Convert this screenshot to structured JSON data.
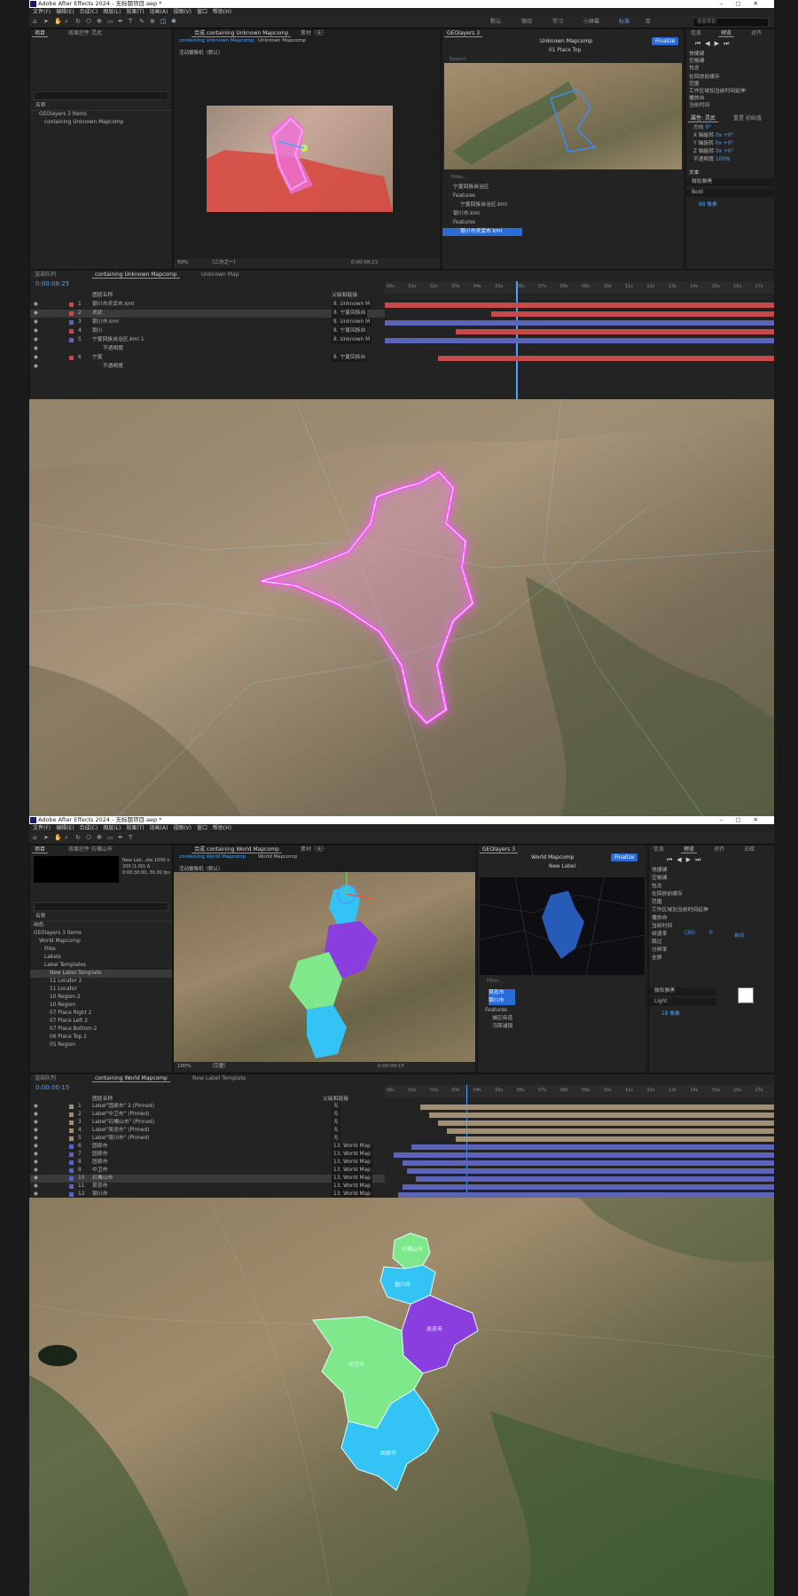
{
  "screen1": {
    "window_title": "Adobe After Effects 2024 - 无标题项目.aep *",
    "menu": [
      "文件(F)",
      "编辑(E)",
      "合成(C)",
      "图层(L)",
      "效果(T)",
      "动画(A)",
      "视图(V)",
      "窗口",
      "帮助(H)"
    ],
    "workspaces": [
      "默认",
      "审阅",
      "学习",
      "小屏幕",
      "标准",
      "库"
    ],
    "search_placeholder": "搜索帮助",
    "project_tab": "项目",
    "project_tab2": "效果控件 灵武",
    "project_header": "名称",
    "project_items": [
      "GEOlayers 3 Items",
      "containing Unknown Mapcomp"
    ],
    "comp_tab": "合成 containing Unknown Mapcomp",
    "comp_tab2": "素材（无）",
    "comp_breadcrumb1": "containing Unknown Mapcomp",
    "comp_breadcrumb2": "Unknown Mapcomp",
    "camera_label": "活动摄像机（默认）",
    "zoom": "50%",
    "resolution": "（二分之一）",
    "comp_time": "0:00:08:23",
    "geo_panel_title": "GEOlayers 3",
    "geo_map_title": "Unknown Mapcomp",
    "geo_place": "01 Place Top",
    "finalize": "Finalize",
    "geo_search": "Search",
    "geo_filter": "Filter...",
    "geo_tree": [
      "宁夏回族自治区",
      "Features",
      "宁夏回族自治区.kml",
      "银川市.kml",
      "Features",
      "银川市灵武市.kml"
    ],
    "right_tabs": [
      "信息",
      "预览",
      "对齐"
    ],
    "right_props": [
      "快捷键",
      "空格键",
      "包含",
      "在回放前缓存",
      "范围",
      "工作区域加当前时间延伸",
      "播放自",
      "当前时间"
    ],
    "props_tab": "属性: 灵武",
    "props_tab2": "重置 初始值",
    "props_rows": [
      "方向",
      "X 轴旋转",
      "Y 轴旋转",
      "Z 轴旋转",
      "不透明度"
    ],
    "props_values": [
      "0°",
      "0x +0°",
      "0x +0°",
      "0x +0°",
      "100%"
    ],
    "text_panel": "文本",
    "text_font": "微软雅黑",
    "text_weight": "Bold",
    "text_size": "98 像素",
    "timeline_tab": "渲染队列",
    "timeline_tab2": "containing Unknown Mapcomp",
    "timeline_tab3": "Unknown Map",
    "timeline_time": "0:00:08:25",
    "timeline_col_name": "图层名称",
    "timeline_col_parent": "父级和链接",
    "layers": [
      {
        "num": "1",
        "name": "银川市灵武市.kml",
        "parent": "8. Unknown M",
        "color": "#c74a4a"
      },
      {
        "num": "2",
        "name": "灵武",
        "parent": "8. 宁夏回族自",
        "color": "#c74a4a"
      },
      {
        "num": "3",
        "name": "银川市.kml",
        "parent": "8. Unknown M",
        "color": "#5b64b8"
      },
      {
        "num": "4",
        "name": "银川",
        "parent": "8. 宁夏回族自",
        "color": "#c74a4a"
      },
      {
        "num": "5",
        "name": "宁夏回族自治区.kml 1",
        "parent": "8. Unknown M",
        "color": "#5b64b8"
      },
      {
        "num": "",
        "name": "不透明度",
        "parent": "",
        "color": ""
      },
      {
        "num": "6",
        "name": "宁夏",
        "parent": "8. 宁夏回族自",
        "color": "#c74a4a"
      },
      {
        "num": "",
        "name": "不透明度",
        "parent": "",
        "color": ""
      }
    ],
    "opacity_value": "100%",
    "ruler": [
      "00s",
      "01s",
      "02s",
      "03s",
      "04s",
      "05s",
      "06s",
      "07s",
      "08s",
      "09s",
      "10s",
      "11s",
      "12s",
      "13s",
      "14s",
      "15s",
      "16s",
      "17s"
    ]
  },
  "screen2": {
    "window_title": "Adobe After Effects 2024 - 无标题项目.aep *",
    "menu": [
      "文件(F)",
      "编辑(E)",
      "合成(C)",
      "图层(L)",
      "效果(T)",
      "动画(A)",
      "视图(V)",
      "窗口",
      "帮助(H)"
    ],
    "project_tab": "项目",
    "project_tab2": "效果控件 石嘴山市",
    "project_thumb_info": "New Lab...ate  1000 x 200 (1.00)  Δ 0:00:30:00, 30.00 fps",
    "project_header": "名称",
    "project_items": [
      "纯色",
      "GEOlayers 3 Items",
      "World Mapcomp",
      "Files",
      "Labels",
      "Label Templates",
      "New Label Template",
      "11 Locator 2",
      "11 Locator",
      "10 Region 2",
      "10 Region",
      "07 Place Right 2",
      "07 Place Left 2",
      "07 Place Bottom 2",
      "06 Place Top 2",
      "05 Region"
    ],
    "comp_tab": "合成 containing World Mapcomp",
    "comp_tab2": "素材（无）",
    "comp_breadcrumb1": "containing World Mapcomp",
    "comp_breadcrumb2": "World Mapcomp",
    "camera_label": "活动摄像机（默认）",
    "zoom": "100%",
    "resolution": "（完整）",
    "comp_time": "0:00:00:15",
    "geo_panel_title": "GEOlayers 3",
    "geo_map_title": "World Mapcomp",
    "geo_label": "New Label",
    "finalize": "Finalize",
    "geo_filter": "Filter...",
    "geo_tree": [
      "吴忠市",
      "银川市",
      "Features",
      "城区街道",
      "乌斯浦镇"
    ],
    "right_tabs": [
      "信息",
      "预览",
      "对齐",
      "古碳"
    ],
    "right_props": [
      "快捷键",
      "空格键",
      "包含",
      "在回放前缓存",
      "范围",
      "工作区域加当前时间延伸",
      "播放自",
      "当前时间",
      "帧速率",
      "跳过",
      "分辨率",
      "全屏"
    ],
    "right_values": [
      "(30)",
      "0",
      "自动"
    ],
    "text_font": "微软雅黑",
    "text_weight": "Light",
    "text_size": "18 像素",
    "timeline_tab": "渲染队列",
    "timeline_tab2": "containing World Mapcomp",
    "timeline_tab3": "New Label Template",
    "timeline_time": "0:00:00:15",
    "timeline_col_name": "图层名称",
    "timeline_col_parent": "父级和链接",
    "layers": [
      {
        "num": "1",
        "name": "Label\"固原市\" 2 (Pinned)",
        "parent": "无",
        "color": "#a08f74"
      },
      {
        "num": "2",
        "name": "Label\"中卫市\" (Pinned)",
        "parent": "无",
        "color": "#a08f74"
      },
      {
        "num": "3",
        "name": "Label\"石嘴山市\" (Pinned)",
        "parent": "无",
        "color": "#a08f74"
      },
      {
        "num": "4",
        "name": "Label\"吴忠市\" (Pinned)",
        "parent": "无",
        "color": "#a08f74"
      },
      {
        "num": "5",
        "name": "Label\"银川市\" (Pinned)",
        "parent": "无",
        "color": "#a08f74"
      },
      {
        "num": "6",
        "name": "固原市",
        "parent": "13. World Map",
        "color": "#5b64b8"
      },
      {
        "num": "7",
        "name": "固原市",
        "parent": "13. World Map",
        "color": "#5b64b8"
      },
      {
        "num": "8",
        "name": "固原市",
        "parent": "13. World Map",
        "color": "#5b64b8"
      },
      {
        "num": "9",
        "name": "中卫市",
        "parent": "13. World Map",
        "color": "#5b64b8"
      },
      {
        "num": "10",
        "name": "石嘴山市",
        "parent": "13. World Map",
        "color": "#5b64b8"
      },
      {
        "num": "11",
        "name": "吴忠市",
        "parent": "13. World Map",
        "color": "#5b64b8"
      },
      {
        "num": "12",
        "name": "银川市",
        "parent": "13. World Map",
        "color": "#5b64b8"
      }
    ],
    "ruler": [
      "00s",
      "01s",
      "02s",
      "03s",
      "04s",
      "05s",
      "06s",
      "07s",
      "08s",
      "09s",
      "10s",
      "11s",
      "12s",
      "13s",
      "14s",
      "15s",
      "16s",
      "17s"
    ]
  },
  "map_labels": {
    "shizuishan": "石嘴山市",
    "yinchuan": "银川市",
    "wuzhong": "吴忠市",
    "zhongwei": "中卫市",
    "guyuan": "固原市"
  },
  "colors": {
    "accent": "#4aa3ff",
    "neon": "#ff4dff",
    "region_blue": "#33c3f5",
    "region_purple": "#8a3ee0",
    "region_green": "#7ee88a",
    "layer_red": "#c74a4a",
    "layer_blue": "#5b64b8",
    "layer_tan": "#a08f74"
  }
}
